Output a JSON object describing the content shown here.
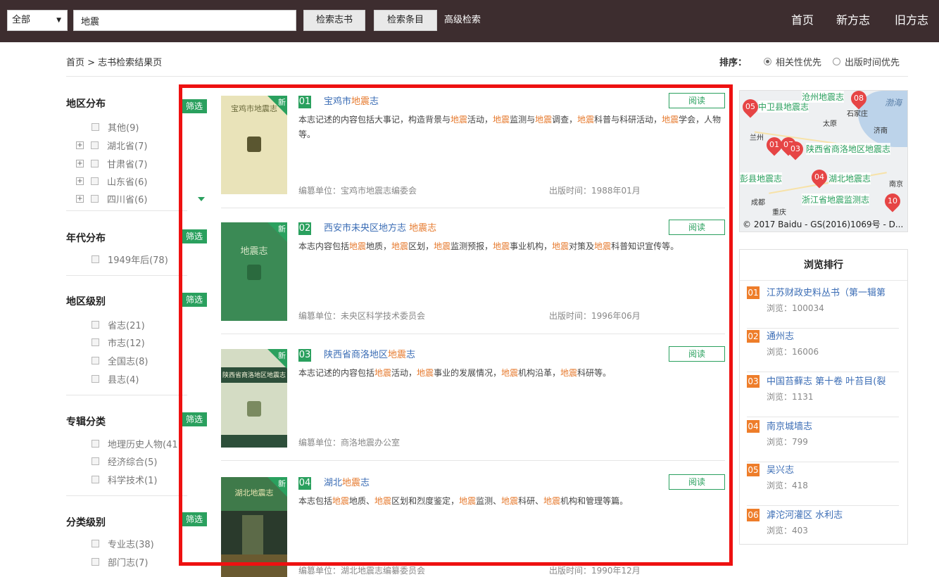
{
  "topbar": {
    "scope": "全部",
    "query": "地震",
    "search_books_label": "检索志书",
    "search_entries_label": "检索条目",
    "advanced_label": "高级检索",
    "nav": [
      "首页",
      "新方志",
      "旧方志"
    ]
  },
  "breadcrumb": "首页 > 志书检索结果页",
  "sort": {
    "title": "排序：",
    "options": [
      "相关性优先",
      "出版时间优先"
    ],
    "selected": "相关性优先"
  },
  "filters": {
    "filter_tag": "筛选",
    "region": {
      "title": "地区分布",
      "items": [
        "其他(9)",
        "湖北省(7)",
        "甘肃省(7)",
        "山东省(6)",
        "四川省(6)"
      ]
    },
    "era": {
      "title": "年代分布",
      "items": [
        "1949年后(78)"
      ]
    },
    "level": {
      "title": "地区级别",
      "items": [
        "省志(21)",
        "市志(12)",
        "全国志(8)",
        "县志(4)"
      ]
    },
    "album": {
      "title": "专辑分类",
      "items": [
        "地理历史人物(41",
        "经济综合(5)",
        "科学技术(1)"
      ]
    },
    "category": {
      "title": "分类级别",
      "items": [
        "专业志(38)",
        "部门志(7)"
      ]
    }
  },
  "results": [
    {
      "num": "01",
      "title_plain": "宝鸡市",
      "title_hl": "地震",
      "title_tail": "志",
      "desc_parts": [
        "本志记述的内容包括大事记，构造背景与",
        "地震",
        "活动，",
        "地震",
        "监测与",
        "地震",
        "调查，",
        "地震",
        "科普与科研活动，",
        "地震",
        "学会，人物等。"
      ],
      "editor": "编篡单位：宝鸡市地震志编委会",
      "date": "出版时间：1988年01月",
      "read_label": "阅读",
      "new_label": "新",
      "cover_title": "宝鸡市地震志"
    },
    {
      "num": "02",
      "title_plain": "西安市未央区地方志 ",
      "title_hl": "地震",
      "title_tail": "志",
      "desc_parts": [
        "本志内容包括",
        "地震",
        "地质，",
        "地震",
        "区划，",
        "地震",
        "监测预报，",
        "地震",
        "事业机构，",
        "地震",
        "对策及",
        "地震",
        "科普知识宣传等。"
      ],
      "editor": "编篡单位：未央区科学技术委员会",
      "date": "出版时间：1996年06月",
      "read_label": "阅读",
      "new_label": "新",
      "cover_title": "地震志"
    },
    {
      "num": "03",
      "title_plain": "陕西省商洛地区",
      "title_hl": "地震",
      "title_tail": "志",
      "desc_parts": [
        "本志记述的内容包括",
        "地震",
        "活动，",
        "地震",
        "事业的发展情况，",
        "地震",
        "机构沿革，",
        "地震",
        "科研等。"
      ],
      "editor": "编篡单位：商洛地震办公室",
      "date": "",
      "read_label": "阅读",
      "new_label": "新",
      "cover_title": "陕西省商洛地区地震志"
    },
    {
      "num": "04",
      "title_plain": "湖北",
      "title_hl": "地震",
      "title_tail": "志",
      "desc_parts": [
        "本志包括",
        "地震",
        "地质、",
        "地震",
        "区划和烈度鉴定，",
        "地震",
        "监测、",
        "地震",
        "科研、",
        "地震",
        "机构和管理等篇。"
      ],
      "editor": "编篡单位：湖北地震志编纂委员会",
      "date": "出版时间：1990年12月",
      "read_label": "阅读",
      "new_label": "新",
      "cover_title": "湖北地震志"
    }
  ],
  "map": {
    "labels": [
      "中卫县地震志",
      "陕西省商洛地区地震志",
      "彭县地震志",
      "湖北地震志",
      "浙江省地震监测志",
      "沧州地震志"
    ],
    "pins": [
      "05",
      "08",
      "01",
      "07",
      "03",
      "04",
      "10"
    ],
    "cities": [
      "太原",
      "石家庄",
      "济南",
      "兰州",
      "成都",
      "重庆",
      "南京",
      "渤海"
    ],
    "copyright": "© 2017 Baidu - GS(2016)1069号 - D..."
  },
  "ranking": {
    "title": "浏览排行",
    "items": [
      {
        "num": "01",
        "title": "江苏财政史料丛书（第一辑第",
        "views": "浏览：100034"
      },
      {
        "num": "02",
        "title": "通州志",
        "views": "浏览：16006"
      },
      {
        "num": "03",
        "title": "中国苔藓志 第十卷 叶苔目(裂",
        "views": "浏览：1131"
      },
      {
        "num": "04",
        "title": "南京城墙志",
        "views": "浏览：799"
      },
      {
        "num": "05",
        "title": "吴兴志",
        "views": "浏览：418"
      },
      {
        "num": "06",
        "title": "滹沱河灌区 水利志",
        "views": "浏览：403"
      }
    ]
  },
  "colors": {
    "topbar": "#3d2d2f",
    "accent_green": "#2aa05e",
    "highlight_orange": "#e67a2e",
    "link_blue": "#3b6db5",
    "frame_red": "#ee1111"
  }
}
